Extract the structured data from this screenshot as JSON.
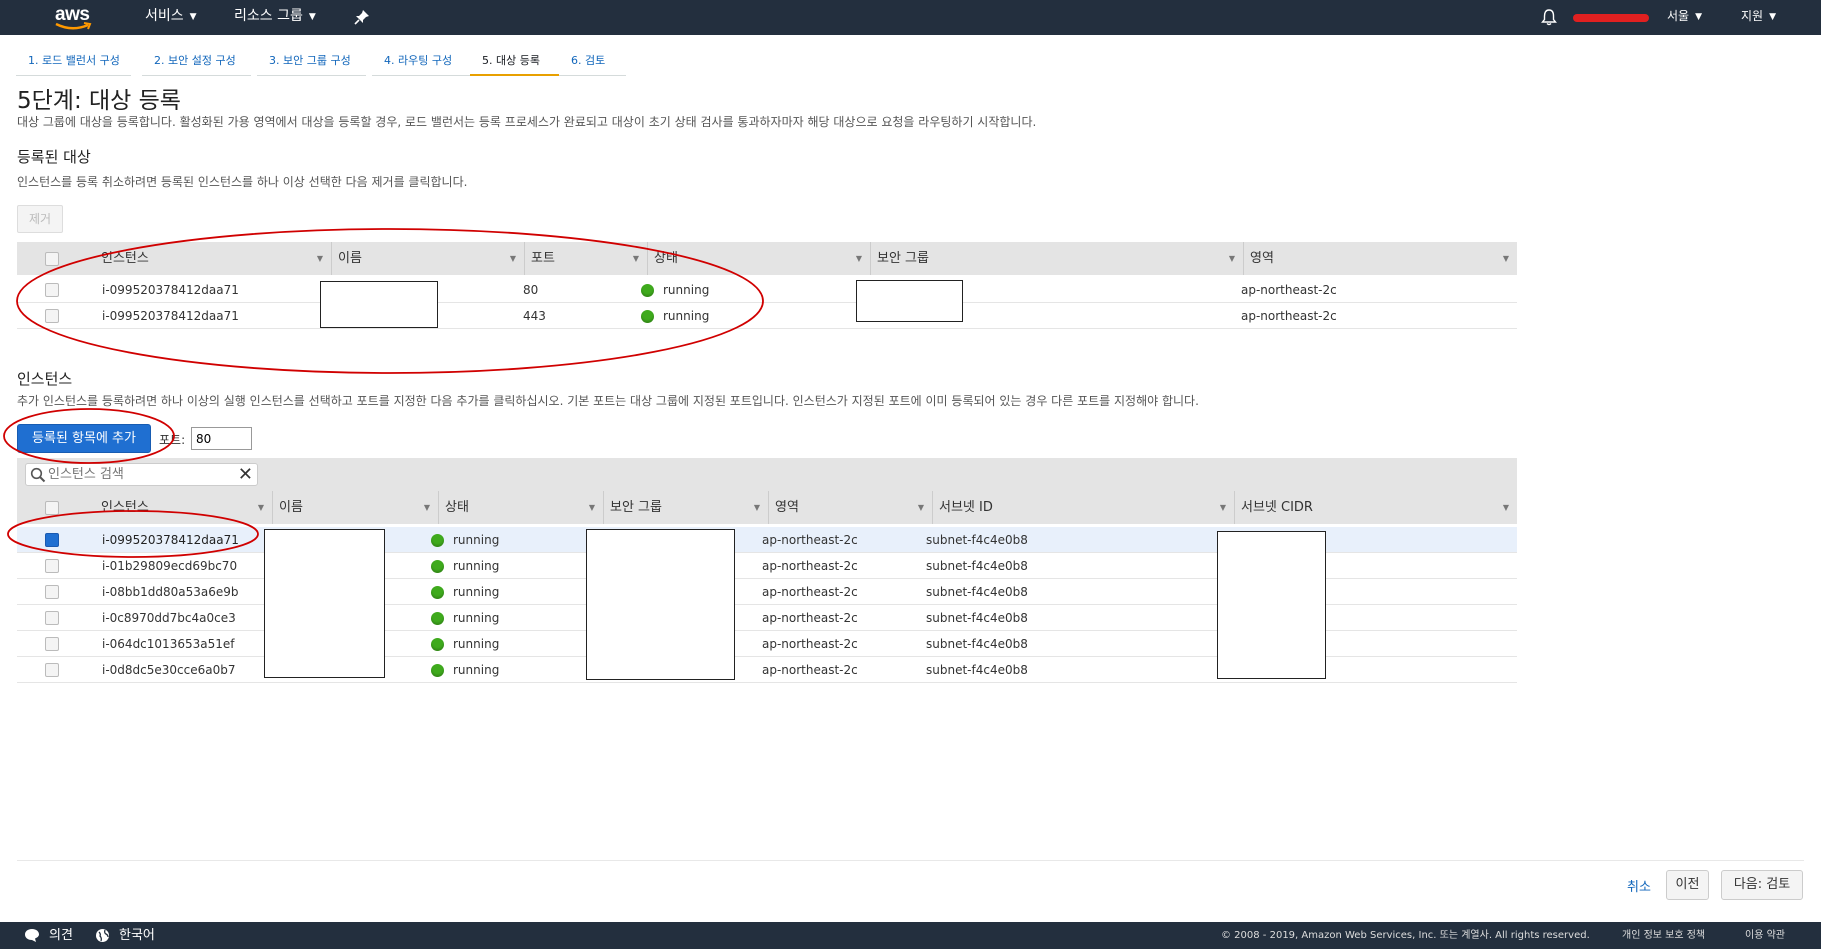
{
  "topnav": {
    "logo": "aws",
    "services": "서비스",
    "resource_groups": "리소스 그룹",
    "region": "서울",
    "support": "지원"
  },
  "tabs": [
    {
      "label": "1. 로드 밸런서 구성"
    },
    {
      "label": "2. 보안 설정 구성"
    },
    {
      "label": "3. 보안 그룹 구성"
    },
    {
      "label": "4. 라우팅 구성"
    },
    {
      "label": "5. 대상 등록"
    },
    {
      "label": "6. 검토"
    }
  ],
  "page": {
    "title": "5단계: 대상 등록",
    "description": "대상 그룹에 대상을 등록합니다. 활성화된 가용 영역에서 대상을 등록할 경우, 로드 밸런서는 등록 프로세스가 완료되고 대상이 초기 상태 검사를 통과하자마자 해당 대상으로 요청을 라우팅하기 시작합니다."
  },
  "registered": {
    "title": "등록된 대상",
    "description": "인스턴스를 등록 취소하려면 등록된 인스턴스를 하나 이상 선택한 다음 제거를 클릭합니다.",
    "remove_button": "제거",
    "columns": [
      "인스턴스",
      "이름",
      "포트",
      "상태",
      "보안 그룹",
      "영역"
    ],
    "rows": [
      {
        "instance": "i-099520378412daa71",
        "port": "80",
        "status": "running",
        "zone": "ap-northeast-2c"
      },
      {
        "instance": "i-099520378412daa71",
        "port": "443",
        "status": "running",
        "zone": "ap-northeast-2c"
      }
    ]
  },
  "instances": {
    "title": "인스턴스",
    "description": "추가 인스턴스를 등록하려면 하나 이상의 실행 인스턴스를 선택하고 포트를 지정한 다음 추가를 클릭하십시오. 기본 포트는 대상 그룹에 지정된 포트입니다. 인스턴스가 지정된 포트에 이미 등록되어 있는 경우 다른 포트를 지정해야 합니다.",
    "add_button": "등록된 항목에 추가",
    "port_label": "포트:",
    "port_value": "80",
    "search_placeholder": "인스턴스 검색",
    "columns": [
      "인스턴스",
      "이름",
      "상태",
      "보안 그룹",
      "영역",
      "서브넷 ID",
      "서브넷 CIDR"
    ],
    "rows": [
      {
        "instance": "i-099520378412daa71",
        "status": "running",
        "zone": "ap-northeast-2c",
        "subnet": "subnet-f4c4e0b8",
        "selected": true
      },
      {
        "instance": "i-01b29809ecd69bc70",
        "status": "running",
        "zone": "ap-northeast-2c",
        "subnet": "subnet-f4c4e0b8",
        "selected": false
      },
      {
        "instance": "i-08bb1dd80a53a6e9b",
        "status": "running",
        "zone": "ap-northeast-2c",
        "subnet": "subnet-f4c4e0b8",
        "selected": false
      },
      {
        "instance": "i-0c8970dd7bc4a0ce3",
        "status": "running",
        "zone": "ap-northeast-2c",
        "subnet": "subnet-f4c4e0b8",
        "selected": false
      },
      {
        "instance": "i-064dc1013653a51ef",
        "status": "running",
        "zone": "ap-northeast-2c",
        "subnet": "subnet-f4c4e0b8",
        "selected": false
      },
      {
        "instance": "i-0d8dc5e30cce6a0b7",
        "status": "running",
        "zone": "ap-northeast-2c",
        "subnet": "subnet-f4c4e0b8",
        "selected": false
      }
    ]
  },
  "actions": {
    "cancel": "취소",
    "previous": "이전",
    "next": "다음: 검토"
  },
  "footer": {
    "feedback": "의견",
    "language": "한국어",
    "copyright": "© 2008 - 2019, Amazon Web Services, Inc. 또는 계열사. All rights reserved.",
    "privacy": "개인 정보 보호 정책",
    "terms": "이용 약관"
  },
  "colors": {
    "nav_bg": "#232f3e",
    "primary": "#1f6fd1",
    "running": "#3faa1d",
    "annotation": "#d00000"
  }
}
